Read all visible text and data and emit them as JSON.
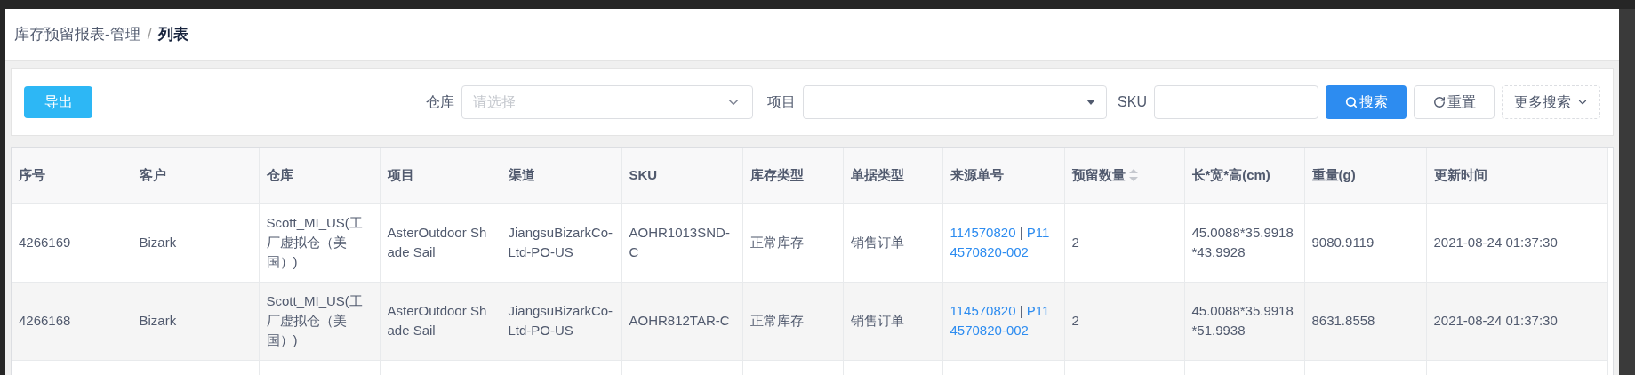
{
  "breadcrumb": {
    "parent": "库存预留报表-管理",
    "separator": "/",
    "current": "列表"
  },
  "toolbar": {
    "export_button": "导出",
    "filters": [
      {
        "kind": "select",
        "label": "仓库",
        "placeholder": "请选择"
      },
      {
        "kind": "dropdown",
        "label": "项目"
      },
      {
        "kind": "input",
        "label": "SKU"
      }
    ],
    "search_button": "搜索",
    "reset_button": "重置",
    "more_button": "更多搜索"
  },
  "table": {
    "columns": [
      {
        "label": "序号",
        "sortable": false
      },
      {
        "label": "客户",
        "sortable": false
      },
      {
        "label": "仓库",
        "sortable": false
      },
      {
        "label": "项目",
        "sortable": false
      },
      {
        "label": "渠道",
        "sortable": false
      },
      {
        "label": "SKU",
        "sortable": false
      },
      {
        "label": "库存类型",
        "sortable": false
      },
      {
        "label": "单据类型",
        "sortable": false
      },
      {
        "label": "来源单号",
        "sortable": false
      },
      {
        "label": "预留数量",
        "sortable": true
      },
      {
        "label": "长*宽*高(cm)",
        "sortable": false
      },
      {
        "label": "重量(g)",
        "sortable": false
      },
      {
        "label": "更新时间",
        "sortable": false
      }
    ],
    "rows": [
      {
        "cells": [
          "4266169",
          "Bizark",
          "Scott_MI_US(工厂虚拟仓（美国）)",
          "AsterOutdoor Shade Sail",
          "JiangsuBizarkCo-Ltd-PO-US",
          "AOHR1013SND-C",
          "正常库存",
          "销售订单",
          {
            "links": [
              "114570820",
              "P114570820-002"
            ],
            "separator": "|"
          },
          "2",
          "45.0088*35.9918*43.9928",
          "9080.9119",
          "2021-08-24 01:37:30"
        ]
      },
      {
        "cells": [
          "4266168",
          "Bizark",
          "Scott_MI_US(工厂虚拟仓（美国）)",
          "AsterOutdoor Shade Sail",
          "JiangsuBizarkCo-Ltd-PO-US",
          "AOHR812TAR-C",
          "正常库存",
          "销售订单",
          {
            "links": [
              "114570820",
              "P114570820-002"
            ],
            "separator": "|"
          },
          "2",
          "45.0088*35.9918*51.9938",
          "8631.8558",
          "2021-08-24 01:37:30"
        ]
      }
    ]
  }
}
